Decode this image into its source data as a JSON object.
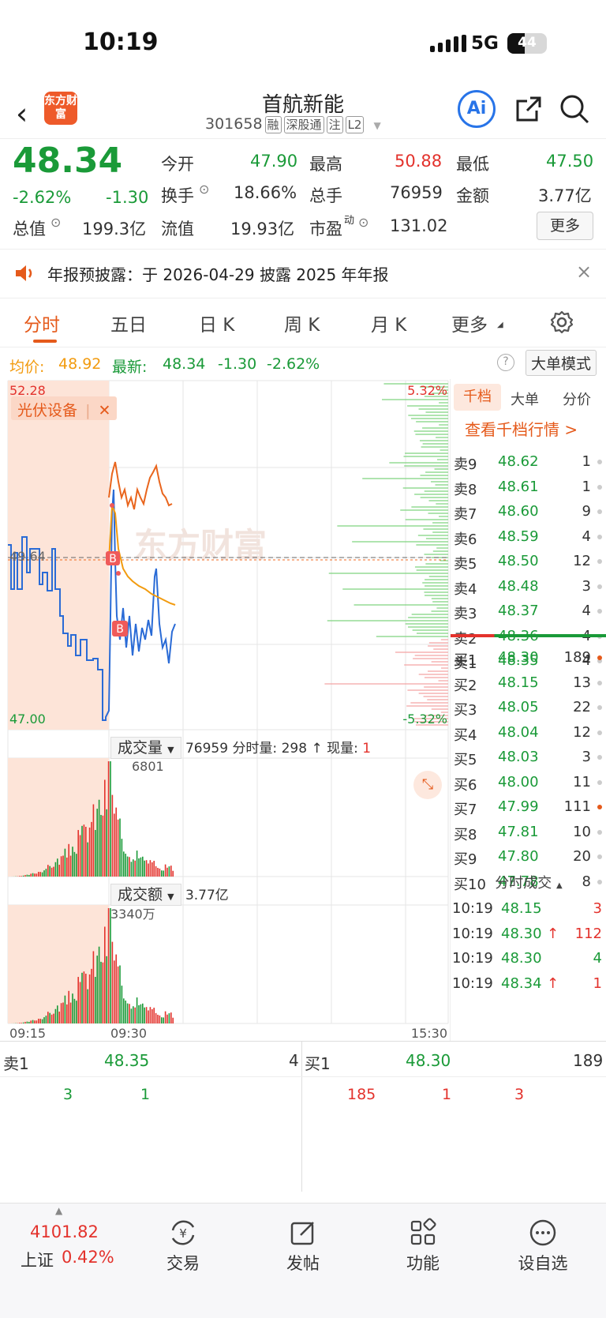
{
  "status": {
    "time": "10:19",
    "network": "5G",
    "battery": "44"
  },
  "header": {
    "logo": "东方财富",
    "name": "首航新能",
    "code": "301658",
    "tags": [
      "融",
      "深股通",
      "注",
      "L2"
    ],
    "ai": "Ai"
  },
  "quote": {
    "price": "48.34",
    "change_pct": "-2.62%",
    "change": "-1.30",
    "open_label": "今开",
    "open": "47.90",
    "high_label": "最高",
    "high": "50.88",
    "low_label": "最低",
    "low": "47.50",
    "turnover_label": "换手",
    "turnover": "18.66%",
    "volume_label": "总手",
    "volume": "76959",
    "amount_label": "金额",
    "amount": "3.77亿",
    "mktcap_label": "总值",
    "mktcap": "199.3亿",
    "float_label": "流值",
    "float": "19.93亿",
    "pe_label": "市盈",
    "pe_sup": "动",
    "pe": "131.02",
    "more": "更多"
  },
  "notice": {
    "text": "年报预披露：于 2026-04-29 披露 2025 年年报"
  },
  "tabs": [
    "分时",
    "五日",
    "日 K",
    "周 K",
    "月 K",
    "更多"
  ],
  "avgline": {
    "avg_label": "均价:",
    "avg": "48.92",
    "latest_label": "最新:",
    "latest": "48.34",
    "change": "-1.30",
    "change_pct": "-2.62%",
    "mode": "大单模式"
  },
  "chart": {
    "price_high": "52.28",
    "price_mid": "49.64",
    "price_low": "47.00",
    "pct_high": "5.32%",
    "pct_low": "-5.32%",
    "sector_tag": "光伏设备",
    "sector_close": "✕",
    "watermark": "东方财富",
    "vol_label": "成交量",
    "vol_total": "76959",
    "vol_minute_label": "分时量:",
    "vol_minute": "298",
    "vol_now_label": "现量:",
    "vol_now": "1",
    "vol_max": "6801",
    "amt_label": "成交额",
    "amt_total": "3.77亿",
    "amt_max": "3340万",
    "x_start": "09:15",
    "x_mid": "09:30",
    "x_end": "15:30"
  },
  "orderbook": {
    "tabs": [
      "千档",
      "大单",
      "分价"
    ],
    "link": "查看千档行情 >",
    "asks": [
      {
        "label": "卖9",
        "price": "48.62",
        "vol": "1"
      },
      {
        "label": "卖8",
        "price": "48.61",
        "vol": "1"
      },
      {
        "label": "卖7",
        "price": "48.60",
        "vol": "9"
      },
      {
        "label": "卖6",
        "price": "48.59",
        "vol": "4"
      },
      {
        "label": "卖5",
        "price": "48.50",
        "vol": "12"
      },
      {
        "label": "卖4",
        "price": "48.48",
        "vol": "3"
      },
      {
        "label": "卖3",
        "price": "48.37",
        "vol": "4"
      },
      {
        "label": "卖2",
        "price": "48.36",
        "vol": "4"
      },
      {
        "label": "卖1",
        "price": "48.35",
        "vol": "4"
      }
    ],
    "bids": [
      {
        "label": "买1",
        "price": "48.30",
        "vol": "189"
      },
      {
        "label": "买2",
        "price": "48.15",
        "vol": "13"
      },
      {
        "label": "买3",
        "price": "48.05",
        "vol": "22"
      },
      {
        "label": "买4",
        "price": "48.04",
        "vol": "12"
      },
      {
        "label": "买5",
        "price": "48.03",
        "vol": "3"
      },
      {
        "label": "买6",
        "price": "48.00",
        "vol": "11"
      },
      {
        "label": "买7",
        "price": "47.99",
        "vol": "111"
      },
      {
        "label": "买8",
        "price": "47.81",
        "vol": "10"
      },
      {
        "label": "买9",
        "price": "47.80",
        "vol": "20"
      },
      {
        "label": "买10",
        "price": "47.78",
        "vol": "8"
      }
    ],
    "ticks_label": "分时成交",
    "ticks": [
      {
        "time": "10:19",
        "price": "48.15",
        "vol": "3",
        "arrow": ""
      },
      {
        "time": "10:19",
        "price": "48.30",
        "vol": "112",
        "arrow": "↑"
      },
      {
        "time": "10:19",
        "price": "48.30",
        "vol": "4",
        "arrow": ""
      },
      {
        "time": "10:19",
        "price": "48.34",
        "vol": "1",
        "arrow": "↑"
      }
    ]
  },
  "bottom": {
    "sell_label": "卖1",
    "sell_price": "48.35",
    "sell_vol": "4",
    "buy_label": "买1",
    "buy_price": "48.30",
    "buy_vol": "189",
    "sell_queue": [
      "3",
      "1"
    ],
    "buy_queue": [
      "185",
      "1",
      "3"
    ]
  },
  "nav": {
    "index_value": "4101.82",
    "index_name": "上证",
    "index_pct": "0.42%",
    "items": [
      "交易",
      "发帖",
      "功能",
      "设自选"
    ]
  },
  "colors": {
    "up": "#e3322c",
    "down": "#1a9a38",
    "accent": "#e55a1b",
    "avg": "#f29b0f",
    "price_line": "#2a6bd6"
  }
}
